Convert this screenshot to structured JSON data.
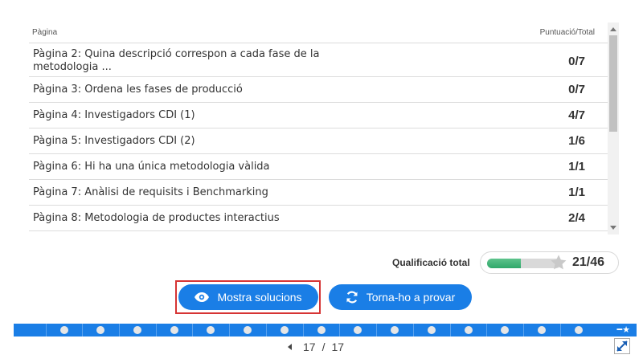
{
  "table": {
    "col_page": "Pàgina",
    "col_score": "Puntuació/Total",
    "rows": [
      {
        "title": "Pàgina 2: Quina descripció correspon a cada fase de la metodologia ...",
        "score": "0/7"
      },
      {
        "title": "Pàgina 3: Ordena les fases de producció",
        "score": "0/7"
      },
      {
        "title": "Pàgina 4: Investigadors CDI (1)",
        "score": "4/7"
      },
      {
        "title": "Pàgina 5: Investigadors CDI (2)",
        "score": "1/6"
      },
      {
        "title": "Pàgina 6: Hi ha una única metodologia vàlida",
        "score": "1/1"
      },
      {
        "title": "Pàgina 7: Anàlisi de requisits i Benchmarking",
        "score": "1/1"
      },
      {
        "title": "Pàgina 8: Metodologia de productes interactius",
        "score": "2/4"
      }
    ]
  },
  "total": {
    "label": "Qualificació total",
    "score": "21/46",
    "progress_fraction": 0.4565
  },
  "buttons": {
    "show_solutions": "Mostra solucions",
    "retry": "Torna-ho a provar"
  },
  "pager": {
    "current": "17",
    "separator": "/",
    "total": "17"
  },
  "colors": {
    "accent": "#1a7ee6",
    "progress": "#2fa86a",
    "highlight": "#d63434"
  }
}
